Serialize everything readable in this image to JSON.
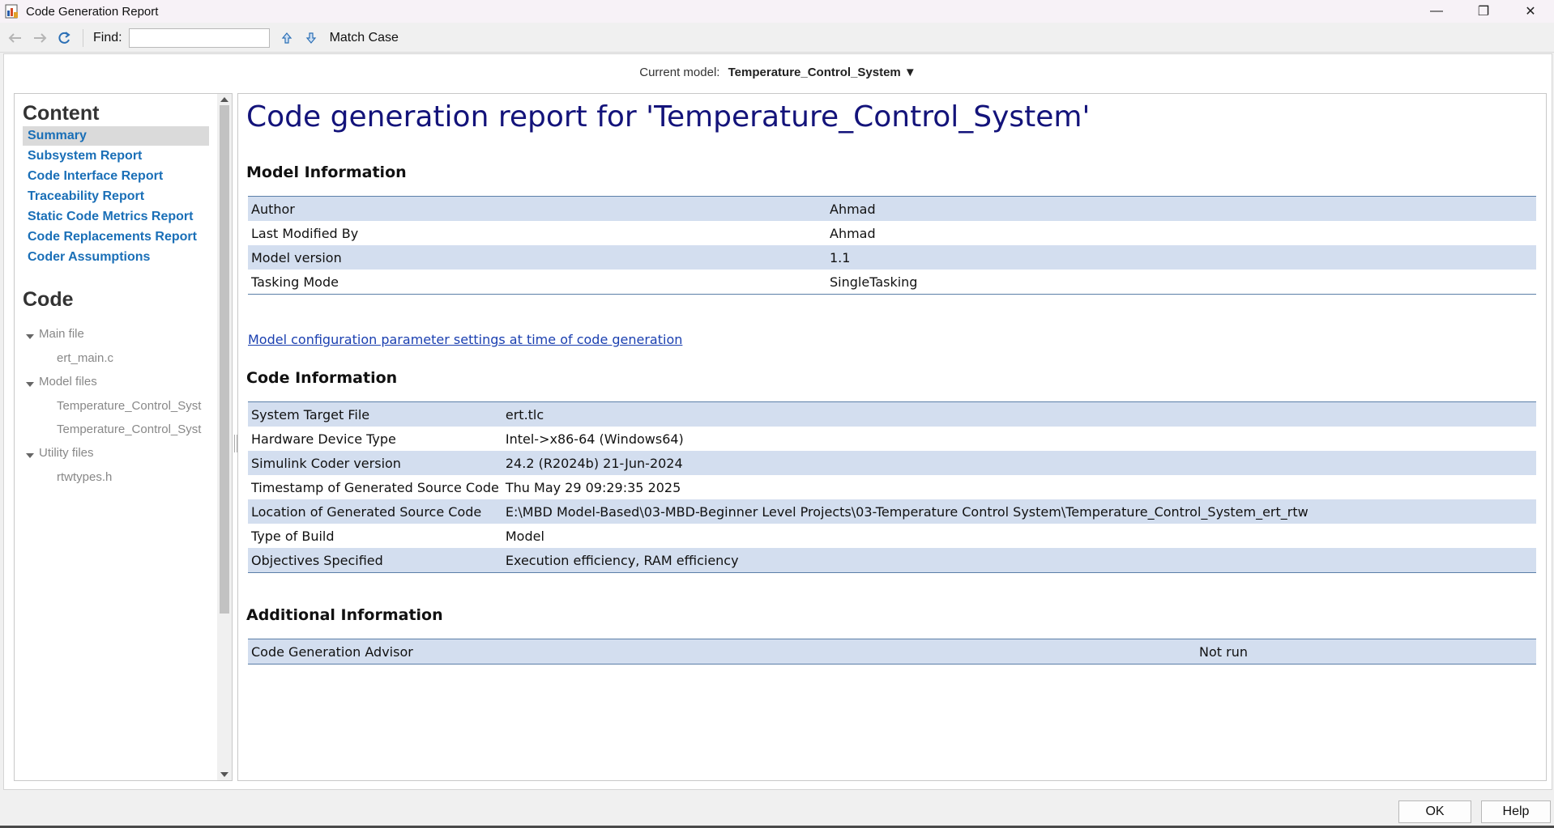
{
  "window": {
    "title": "Code Generation Report",
    "controls": {
      "minimize": "—",
      "restore": "❐",
      "close": "✕"
    }
  },
  "toolbar": {
    "find_label": "Find:",
    "find_value": "",
    "match_case_label": "Match Case"
  },
  "current_model": {
    "label": "Current model:",
    "name": "Temperature_Control_System ▼"
  },
  "nav": {
    "content_heading": "Content",
    "content_links": [
      "Summary",
      "Subsystem Report",
      "Code Interface Report",
      "Traceability Report",
      "Static Code Metrics Report",
      "Code Replacements Report",
      "Coder Assumptions"
    ],
    "code_heading": "Code",
    "groups": [
      {
        "label": "Main file",
        "files": [
          "ert_main.c"
        ]
      },
      {
        "label": "Model files",
        "files": [
          "Temperature_Control_Syst",
          "Temperature_Control_Syst"
        ]
      },
      {
        "label": "Utility files",
        "files": [
          "rtwtypes.h"
        ]
      }
    ]
  },
  "main": {
    "title": "Code generation report for 'Temperature_Control_System'",
    "model_info": {
      "heading": "Model Information",
      "rows": [
        [
          "Author",
          "Ahmad"
        ],
        [
          "Last Modified By",
          "Ahmad"
        ],
        [
          "Model version",
          "1.1"
        ],
        [
          "Tasking Mode",
          "SingleTasking"
        ]
      ]
    },
    "config_link": "Model configuration parameter settings at time of code generation",
    "code_info": {
      "heading": "Code Information",
      "rows": [
        [
          "System Target File",
          "ert.tlc"
        ],
        [
          "Hardware Device Type",
          "Intel->x86-64 (Windows64)"
        ],
        [
          "Simulink Coder version",
          "24.2 (R2024b) 21-Jun-2024"
        ],
        [
          "Timestamp of Generated Source Code",
          "Thu May 29 09:29:35 2025"
        ],
        [
          "Location of Generated Source Code",
          "E:\\MBD Model-Based\\03-MBD-Beginner Level Projects\\03-Temperature Control System\\Temperature_Control_System_ert_rtw"
        ],
        [
          "Type of Build",
          "Model"
        ],
        [
          "Objectives Specified",
          "Execution efficiency, RAM efficiency"
        ]
      ]
    },
    "additional_info": {
      "heading": "Additional Information",
      "rows": [
        [
          "Code Generation Advisor",
          "Not run"
        ]
      ]
    }
  },
  "buttons": {
    "ok": "OK",
    "help": "Help"
  },
  "colors": {
    "title_blue": "#13137a",
    "link_blue": "#1a6fb7",
    "row_stripe": "#d3deef",
    "table_border": "#5b7fa8"
  }
}
